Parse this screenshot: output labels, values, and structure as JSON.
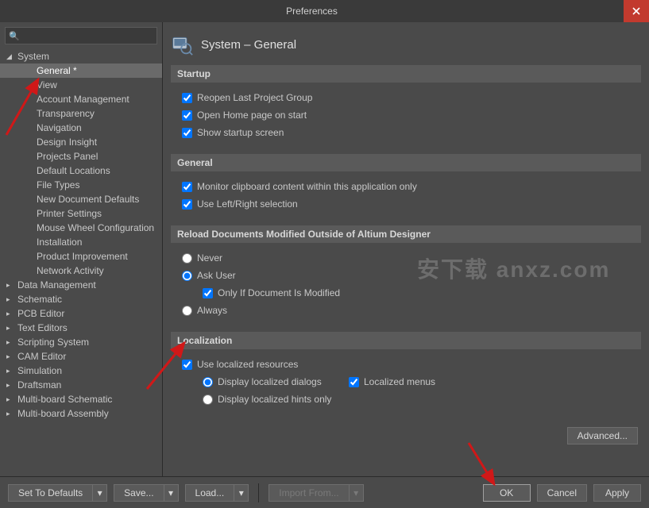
{
  "window": {
    "title": "Preferences"
  },
  "search": {
    "placeholder": ""
  },
  "tree": [
    {
      "label": "System",
      "level": 0,
      "expanded": true,
      "selected": false
    },
    {
      "label": "General *",
      "level": 1,
      "selected": true
    },
    {
      "label": "View",
      "level": 1
    },
    {
      "label": "Account Management",
      "level": 1
    },
    {
      "label": "Transparency",
      "level": 1
    },
    {
      "label": "Navigation",
      "level": 1
    },
    {
      "label": "Design Insight",
      "level": 1
    },
    {
      "label": "Projects Panel",
      "level": 1
    },
    {
      "label": "Default Locations",
      "level": 1
    },
    {
      "label": "File Types",
      "level": 1
    },
    {
      "label": "New Document Defaults",
      "level": 1
    },
    {
      "label": "Printer Settings",
      "level": 1
    },
    {
      "label": "Mouse Wheel Configuration",
      "level": 1
    },
    {
      "label": "Installation",
      "level": 1
    },
    {
      "label": "Product Improvement",
      "level": 1
    },
    {
      "label": "Network Activity",
      "level": 1
    },
    {
      "label": "Data Management",
      "level": 0,
      "expanded": false
    },
    {
      "label": "Schematic",
      "level": 0,
      "expanded": false
    },
    {
      "label": "PCB Editor",
      "level": 0,
      "expanded": false
    },
    {
      "label": "Text Editors",
      "level": 0,
      "expanded": false
    },
    {
      "label": "Scripting System",
      "level": 0,
      "expanded": false
    },
    {
      "label": "CAM Editor",
      "level": 0,
      "expanded": false
    },
    {
      "label": "Simulation",
      "level": 0,
      "expanded": false
    },
    {
      "label": "Draftsman",
      "level": 0,
      "expanded": false
    },
    {
      "label": "Multi-board Schematic",
      "level": 0,
      "expanded": false
    },
    {
      "label": "Multi-board Assembly",
      "level": 0,
      "expanded": false
    }
  ],
  "page": {
    "title": "System – General"
  },
  "sections": {
    "startup": {
      "title": "Startup",
      "opts": [
        {
          "label": "Reopen Last Project Group",
          "checked": true
        },
        {
          "label": "Open Home page on start",
          "checked": true
        },
        {
          "label": "Show startup screen",
          "checked": true
        }
      ]
    },
    "general": {
      "title": "General",
      "opts": [
        {
          "label": "Monitor clipboard content within this application only",
          "checked": true
        },
        {
          "label": "Use Left/Right selection",
          "checked": true
        }
      ]
    },
    "reload": {
      "title": "Reload Documents Modified Outside of Altium Designer",
      "radios": [
        {
          "label": "Never",
          "checked": false
        },
        {
          "label": "Ask User",
          "checked": true
        },
        {
          "label": "Always",
          "checked": false
        }
      ],
      "sub": {
        "label": "Only If Document Is Modified",
        "checked": true
      }
    },
    "localization": {
      "title": "Localization",
      "use": {
        "label": "Use localized resources",
        "checked": true
      },
      "radios": [
        {
          "label": "Display localized dialogs",
          "checked": true
        },
        {
          "label": "Display localized hints only",
          "checked": false
        }
      ],
      "menus": {
        "label": "Localized menus",
        "checked": true
      }
    }
  },
  "buttons": {
    "advanced": "Advanced...",
    "defaults": "Set To Defaults",
    "save": "Save...",
    "load": "Load...",
    "import": "Import From...",
    "ok": "OK",
    "cancel": "Cancel",
    "apply": "Apply"
  },
  "watermark": "安下载 anxz.com"
}
